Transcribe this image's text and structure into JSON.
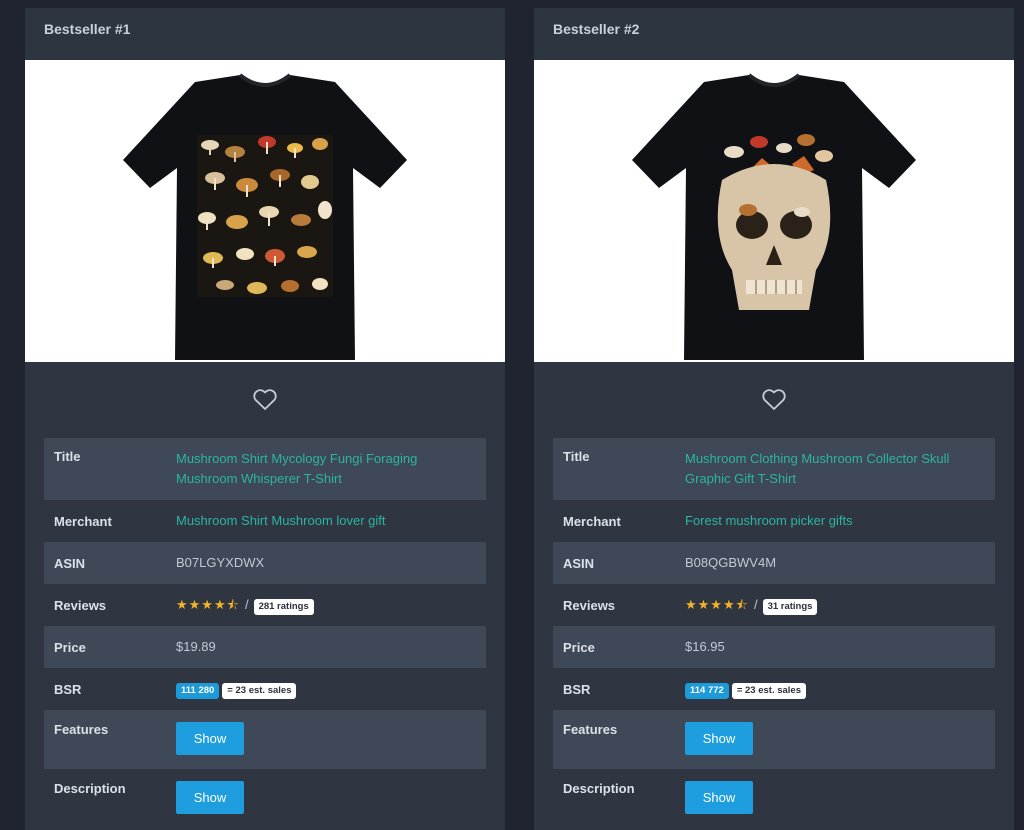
{
  "colors": {
    "background": "#1f2430",
    "card": "#2f3642",
    "row_alt": "#3e4857",
    "link": "#2cb5a0",
    "star": "#f4b324",
    "bsr_badge": "#1d9bd8",
    "button": "#1e9ede"
  },
  "labels": {
    "title": "Title",
    "merchant": "Merchant",
    "asin": "ASIN",
    "reviews": "Reviews",
    "price": "Price",
    "bsr": "BSR",
    "features": "Features",
    "description": "Description",
    "show": "Show",
    "slash": "/"
  },
  "products": [
    {
      "header": "Bestseller #1",
      "image_icon": "mushroom-shirt-image",
      "favorite_icon": "heart-icon",
      "title": "Mushroom Shirt Mycology Fungi Foraging Mushroom Whisperer T-Shirt",
      "merchant": "Mushroom Shirt Mushroom lover gift",
      "asin": "B07LGYXDWX",
      "rating": 4.5,
      "stars": "★★★★⯪",
      "ratings_count": "281 ratings",
      "price": "$19.89",
      "bsr": "111 280",
      "est_sales": "= 23 est. sales"
    },
    {
      "header": "Bestseller #2",
      "image_icon": "skull-shirt-image",
      "favorite_icon": "heart-icon",
      "title": "Mushroom Clothing Mushroom Collector Skull Graphic Gift T-Shirt",
      "merchant": "Forest mushroom picker gifts",
      "asin": "B08QGBWV4M",
      "rating": 4.5,
      "stars": "★★★★⯪",
      "ratings_count": "31 ratings",
      "price": "$16.95",
      "bsr": "114 772",
      "est_sales": "= 23 est. sales"
    }
  ]
}
